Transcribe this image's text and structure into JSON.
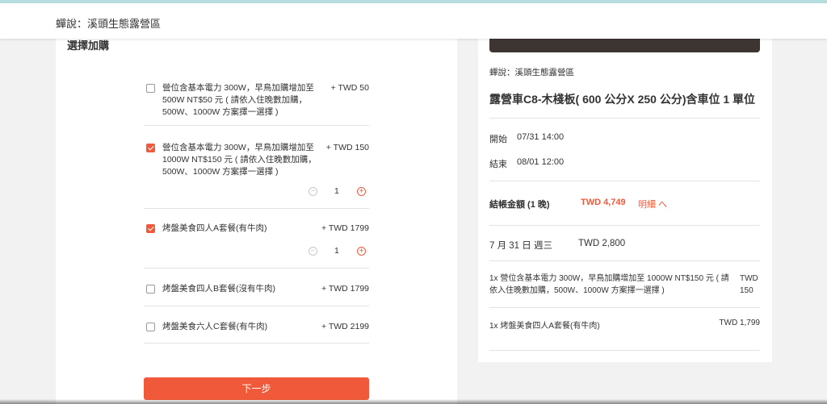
{
  "header": {
    "title": "蟬說：溪頭生態露營區"
  },
  "addons": {
    "section_title": "選擇加購",
    "options": [
      {
        "label": "營位含基本電力 300W，早鳥加購增加至 500W NT$50 元 ( 請依入住晚數加購，500W、1000W 方案擇一選擇 )",
        "price": "+ TWD 50",
        "checked": false
      },
      {
        "label": "營位含基本電力 300W，早鳥加購增加至 1000W NT$150 元 ( 請依入住晚數加購，500W、1000W 方案擇一選擇 )",
        "price": "+ TWD 150",
        "checked": true,
        "quantity": "1"
      },
      {
        "label": "烤盤美食四人A套餐(有牛肉)",
        "price": "+ TWD 1799",
        "checked": true,
        "quantity": "1"
      },
      {
        "label": "烤盤美食四人B套餐(沒有牛肉)",
        "price": "+ TWD 1799",
        "checked": false
      },
      {
        "label": "烤盤美食六人C套餐(有牛肉)",
        "price": "+ TWD 2199",
        "checked": false
      }
    ],
    "next_label": "下一步"
  },
  "summary": {
    "campsite": "蟬說：溪頭生態露營區",
    "unit_title": "露營車C8-木棧板( 600 公分X 250 公分)含車位 1 單位",
    "start_label": "開始",
    "start_value": "07/31 14:00",
    "end_label": "結束",
    "end_value": "08/01 12:00",
    "total_label": "結帳金額 (1 晚)",
    "total_value": "TWD 4,749",
    "detail_link": "明細 へ",
    "date_line": "7 月 31 日 週三",
    "date_price": "TWD 2,800",
    "items": [
      {
        "text": "1x 營位含基本電力 300W，早鳥加購增加至 1000W NT$150 元 ( 請依入住晚數加購，500W、1000W 方案擇一選擇 )",
        "price": "TWD 150"
      },
      {
        "text": "1x 烤盤美食四人A套餐(有牛肉)",
        "price": "TWD 1,799"
      }
    ]
  },
  "colors": {
    "accent": "#f05a3a",
    "background": "#f2f2f2",
    "topline": "#b7dede"
  }
}
